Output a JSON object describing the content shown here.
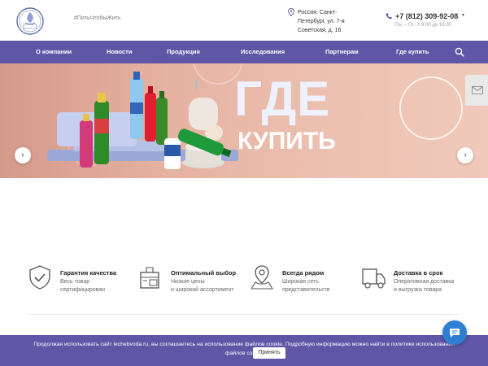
{
  "header": {
    "slogan": "#ПитьЧтобыЖить",
    "address": "Россия, Санкт-Петербург, ул. 7-я Советская, д. 16.",
    "phone": "+7 (812) 309-92-08",
    "hours": "Пн. – Пт.: с 9:00 до 18:00"
  },
  "nav": {
    "items": [
      "О компании",
      "Новости",
      "Продукция",
      "Исследования",
      "Партнерам",
      "Где купить"
    ]
  },
  "hero": {
    "title_line1": "ГДЕ",
    "title_line2": "КУПИТЬ",
    "prev": "‹",
    "next": "›"
  },
  "features": [
    {
      "title": "Гарантия качества",
      "line1": "Весь товар",
      "line2": "сертифицирован",
      "icon": "shield-check-icon"
    },
    {
      "title": "Оптимальный выбор",
      "line1": "Низкие цены",
      "line2": "и широкий ассортимент",
      "icon": "box-tag-icon"
    },
    {
      "title": "Всегда рядом",
      "line1": "Широкая сеть",
      "line2": "представительств",
      "icon": "map-pin-icon"
    },
    {
      "title": "Доставка в срок",
      "line1": "Оперативная доставка",
      "line2": "и выгрузка товара",
      "icon": "delivery-truck-icon"
    }
  ],
  "cookie": {
    "text_line1": "Продолжая использовать сайт lechebvoda.ru, вы соглашаетесь на использование файлов cookie. Подробную информацию можно найти в политике использования",
    "text_line2": "файлов cookie",
    "button": "Принять"
  },
  "colors": {
    "accent": "#5f56a6",
    "chat": "#2e7fd4"
  }
}
